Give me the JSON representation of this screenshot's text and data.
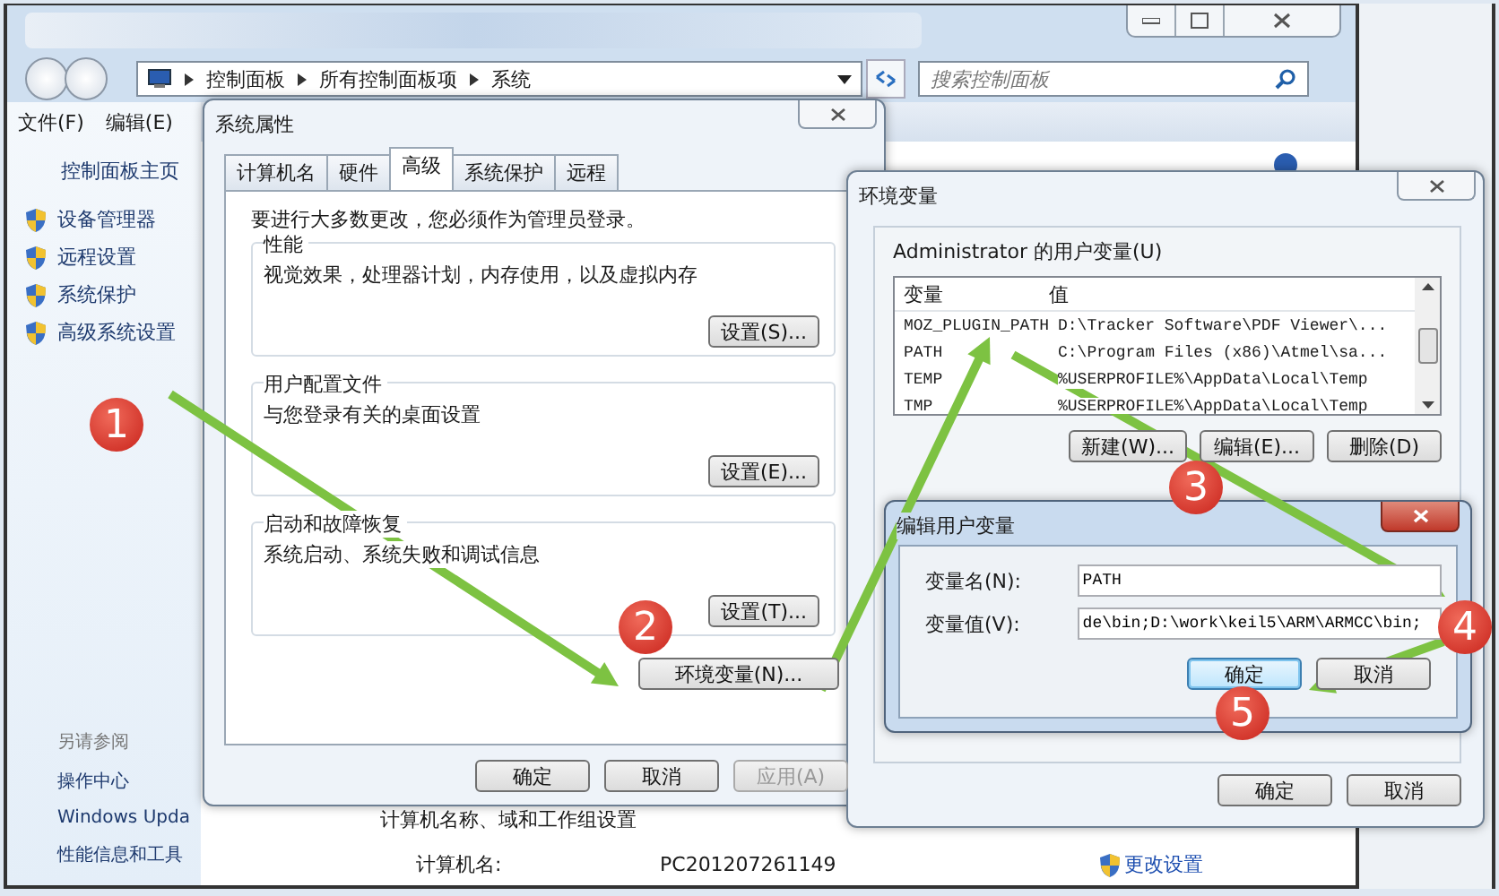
{
  "explorer": {
    "breadcrumbs": [
      "控制面板",
      "所有控制面板项",
      "系统"
    ],
    "search": {
      "placeholder": "搜索控制面板"
    },
    "menu": [
      "文件(F)",
      "编辑(E)"
    ],
    "sidebar": {
      "home": "控制面板主页",
      "tasks": [
        "设备管理器",
        "远程设置",
        "系统保护",
        "高级系统设置"
      ],
      "see_also_heading": "另请参阅",
      "see_also": [
        "操作中心",
        "Windows Upda",
        "性能信息和工具"
      ]
    },
    "section_title": "计算机名称、域和工作组设置",
    "computer_name_label": "计算机名:",
    "computer_name": "PC201207261149",
    "change_settings": "更改设置"
  },
  "system_properties": {
    "title": "系统属性",
    "tabs": [
      {
        "label": "计算机名",
        "selected": false
      },
      {
        "label": "硬件",
        "selected": false
      },
      {
        "label": "高级",
        "selected": true
      },
      {
        "label": "系统保护",
        "selected": false
      },
      {
        "label": "远程",
        "selected": false
      }
    ],
    "notice": "要进行大多数更改，您必须作为管理员登录。",
    "groups": [
      {
        "title": "性能",
        "description": "视觉效果，处理器计划，内存使用，以及虚拟内存",
        "button": "设置(S)..."
      },
      {
        "title": "用户配置文件",
        "description": "与您登录有关的桌面设置",
        "button": "设置(E)..."
      },
      {
        "title": "启动和故障恢复",
        "description": "系统启动、系统失败和调试信息",
        "button": "设置(T)..."
      }
    ],
    "env_button": "环境变量(N)...",
    "buttons": [
      {
        "label": "确定",
        "disabled": false
      },
      {
        "label": "取消",
        "disabled": false
      },
      {
        "label": "应用(A)",
        "disabled": true
      }
    ]
  },
  "environment_variables": {
    "title": "环境变量",
    "user_group_title": "Administrator 的用户变量(U)",
    "columns": [
      "变量",
      "值"
    ],
    "rows": [
      {
        "name": "MOZ_PLUGIN_PATH",
        "value": "D:\\Tracker Software\\PDF Viewer\\..."
      },
      {
        "name": "PATH",
        "value": "C:\\Program Files (x86)\\Atmel\\sa..."
      },
      {
        "name": "TEMP",
        "value": "%USERPROFILE%\\AppData\\Local\\Temp"
      },
      {
        "name": "TMP",
        "value": "%USERPROFILE%\\AppData\\Local\\Temp"
      }
    ],
    "row_buttons": [
      "新建(W)...",
      "编辑(E)...",
      "删除(D)"
    ],
    "buttons": [
      "确定",
      "取消"
    ]
  },
  "edit_dialog": {
    "title": "编辑用户变量",
    "name_label": "变量名(N):",
    "name_value": "PATH",
    "value_label": "变量值(V):",
    "value_value": "de\\bin;D:\\work\\keil5\\ARM\\ARMCC\\bin;",
    "buttons": [
      {
        "label": "确定",
        "focused": true
      },
      {
        "label": "取消",
        "focused": false
      }
    ]
  },
  "annotations": [
    "1",
    "2",
    "3",
    "4",
    "5"
  ]
}
